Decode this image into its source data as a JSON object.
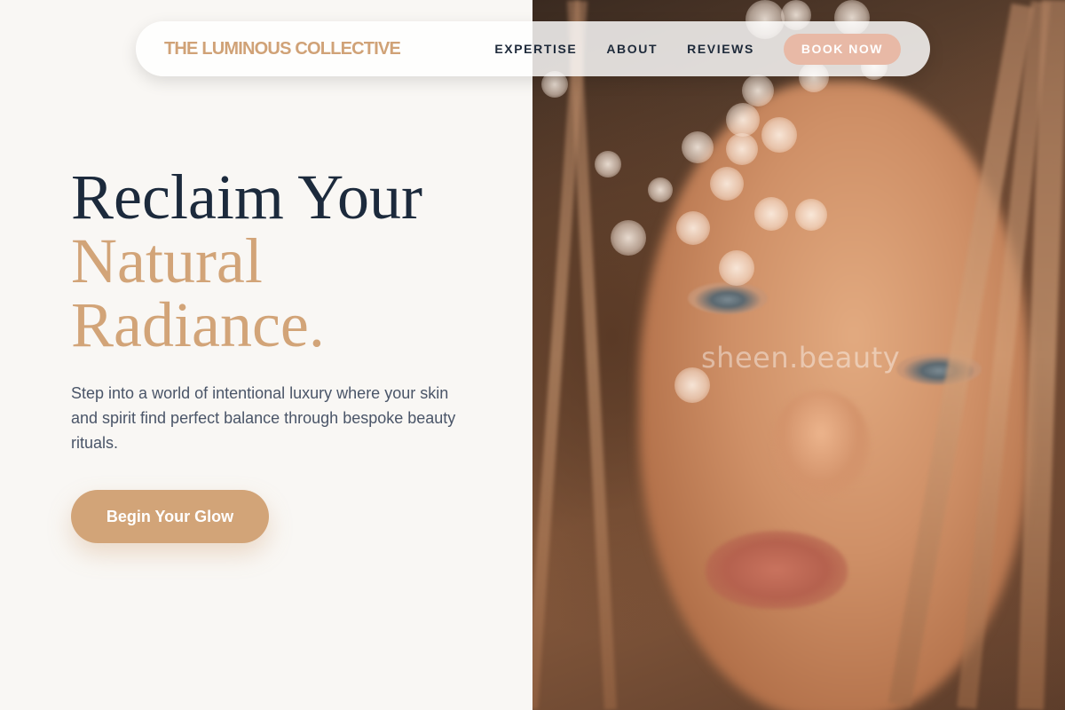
{
  "brand": {
    "name": "THE LUMINOUS COLLECTIVE"
  },
  "nav": {
    "links": [
      "EXPERTISE",
      "ABOUT",
      "REVIEWS"
    ],
    "cta_label": "BOOK NOW"
  },
  "hero": {
    "headline_line1": "Reclaim Your",
    "headline_line2": "Natural",
    "headline_line3": "Radiance.",
    "subtext": "Step into a world of intentional luxury where your skin and spirit find perfect balance through bespoke beauty rituals.",
    "cta_label": "Begin Your Glow",
    "image_watermark": "sheen.beauty"
  },
  "colors": {
    "accent": "#d2a478",
    "book_button": "#e8b9a6",
    "navy_text": "#1c2a3c",
    "page_background": "#f9f7f4"
  }
}
